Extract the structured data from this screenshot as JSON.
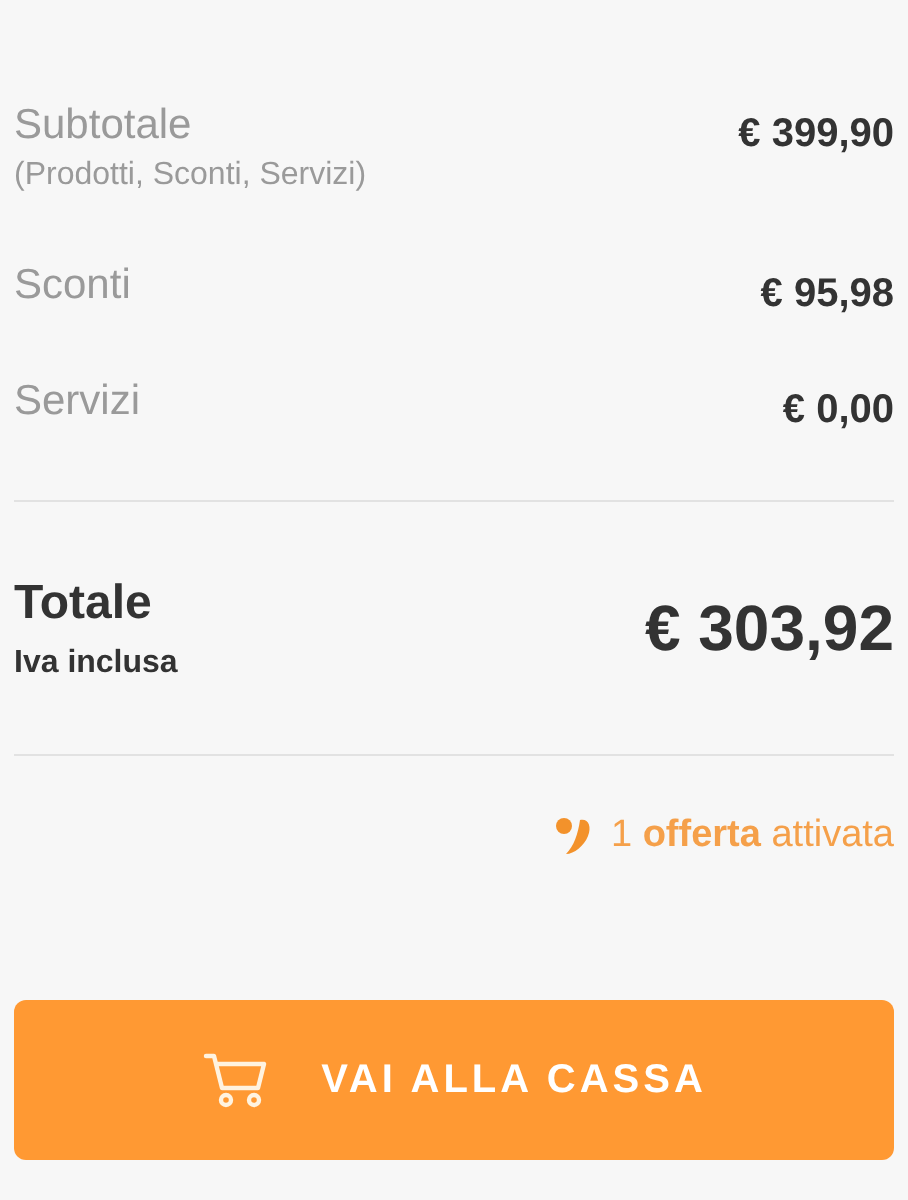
{
  "summary": [
    {
      "label": "Subtotale",
      "note": "(Prodotti, Sconti, Servizi)",
      "value": "€ 399,90"
    },
    {
      "label": "Sconti",
      "value": "€ 95,98"
    },
    {
      "label": "Servizi",
      "value": "€ 0,00"
    }
  ],
  "total": {
    "label": "Totale",
    "note": "Iva inclusa",
    "value": "€ 303,92"
  },
  "offer": {
    "text": "1 **offerta** attivata"
  },
  "checkout_button": {
    "label": "VAI ALLA CASSA"
  }
}
